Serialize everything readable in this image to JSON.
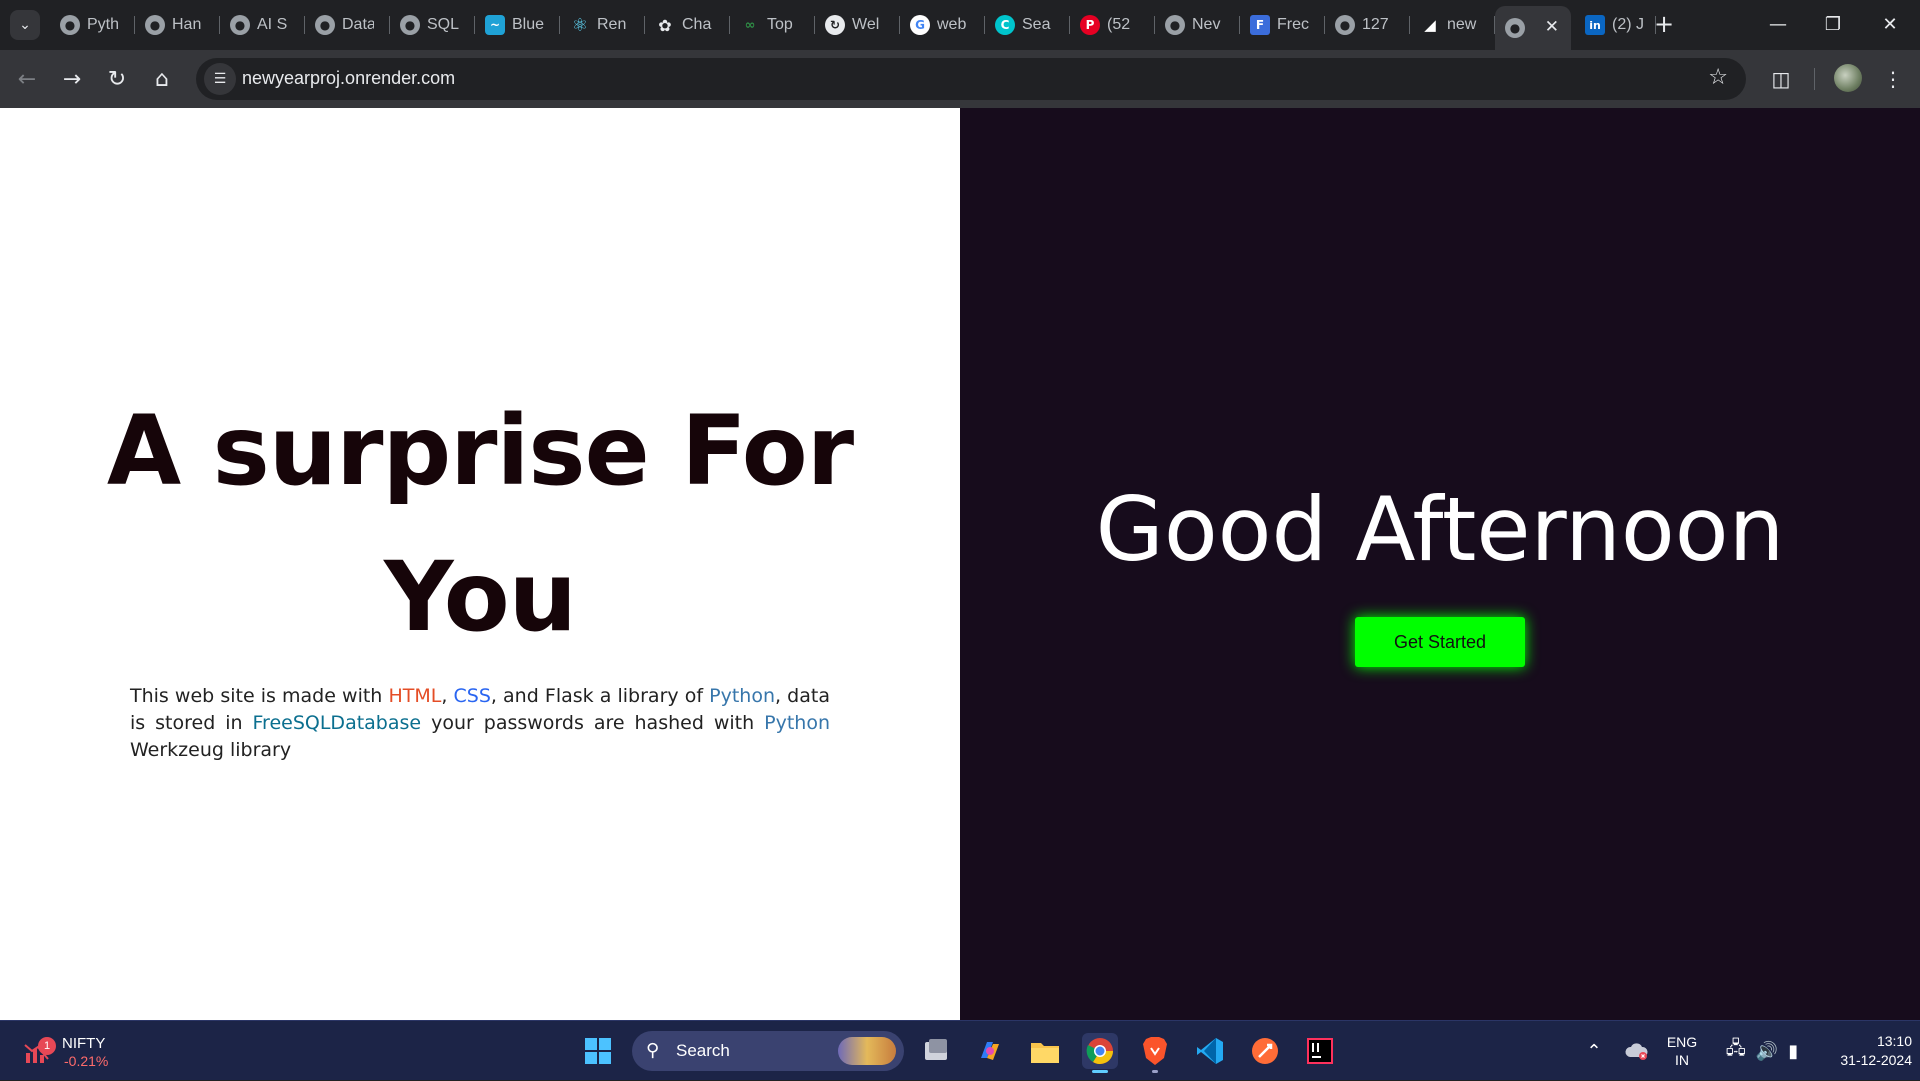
{
  "browser": {
    "tabs": [
      {
        "title": "Pyth",
        "icon": "globe-icon"
      },
      {
        "title": "Han",
        "icon": "globe-icon"
      },
      {
        "title": "AI S",
        "icon": "globe-icon"
      },
      {
        "title": "Data",
        "icon": "globe-icon"
      },
      {
        "title": "SQL",
        "icon": "globe-icon"
      },
      {
        "title": "Blue",
        "icon": "bluesky-icon"
      },
      {
        "title": "Ren",
        "icon": "react-icon"
      },
      {
        "title": "Cha",
        "icon": "chatgpt-icon"
      },
      {
        "title": "Top",
        "icon": "geeksforgeeks-icon"
      },
      {
        "title": "Wel",
        "icon": "swirl-icon"
      },
      {
        "title": "web",
        "icon": "google-icon"
      },
      {
        "title": "Sea",
        "icon": "canva-icon"
      },
      {
        "title": "(52",
        "icon": "pinterest-icon"
      },
      {
        "title": "Nev",
        "icon": "globe-icon"
      },
      {
        "title": "Frec",
        "icon": "form-icon"
      },
      {
        "title": "127",
        "icon": "globe-icon"
      },
      {
        "title": "new",
        "icon": "render-icon"
      },
      {
        "title": "",
        "icon": "globe-icon",
        "active": true
      },
      {
        "title": "(2) J",
        "icon": "linkedin-icon"
      }
    ],
    "url": "newyearproj.onrender.com"
  },
  "page": {
    "headline": "A surprise For You",
    "description": {
      "p1": "This web site is made with ",
      "html": "HTML",
      "sep1": ", ",
      "css": "CSS",
      "p2": ", and Flask a library of ",
      "python1": "Python",
      "p3": ", data is stored in ",
      "freesql": "FreeSQLDatabase",
      "p4": " your passwords are hashed with ",
      "python2": "Python",
      "p5": " Werkzeug library"
    },
    "greeting": "Good Afternoon",
    "cta_label": "Get Started",
    "colors": {
      "left_bg": "#ffffff",
      "right_bg": "#170c1c",
      "headline": "#160509",
      "cta_bg": "#00ff00",
      "html_link": "#e44d26",
      "css_link": "#2965f1",
      "python_link": "#3776ab"
    }
  },
  "taskbar": {
    "widget": {
      "name": "NIFTY",
      "change": "-0.21%",
      "badge": "1"
    },
    "search_label": "Search",
    "apps": [
      "windows-start-icon",
      "task-view-icon",
      "copilot-icon",
      "file-explorer-icon",
      "chrome-icon",
      "brave-icon",
      "vscode-icon",
      "postman-icon",
      "intellij-icon"
    ],
    "language": {
      "line1": "ENG",
      "line2": "IN"
    },
    "time": "13:10",
    "date": "31-12-2024"
  }
}
